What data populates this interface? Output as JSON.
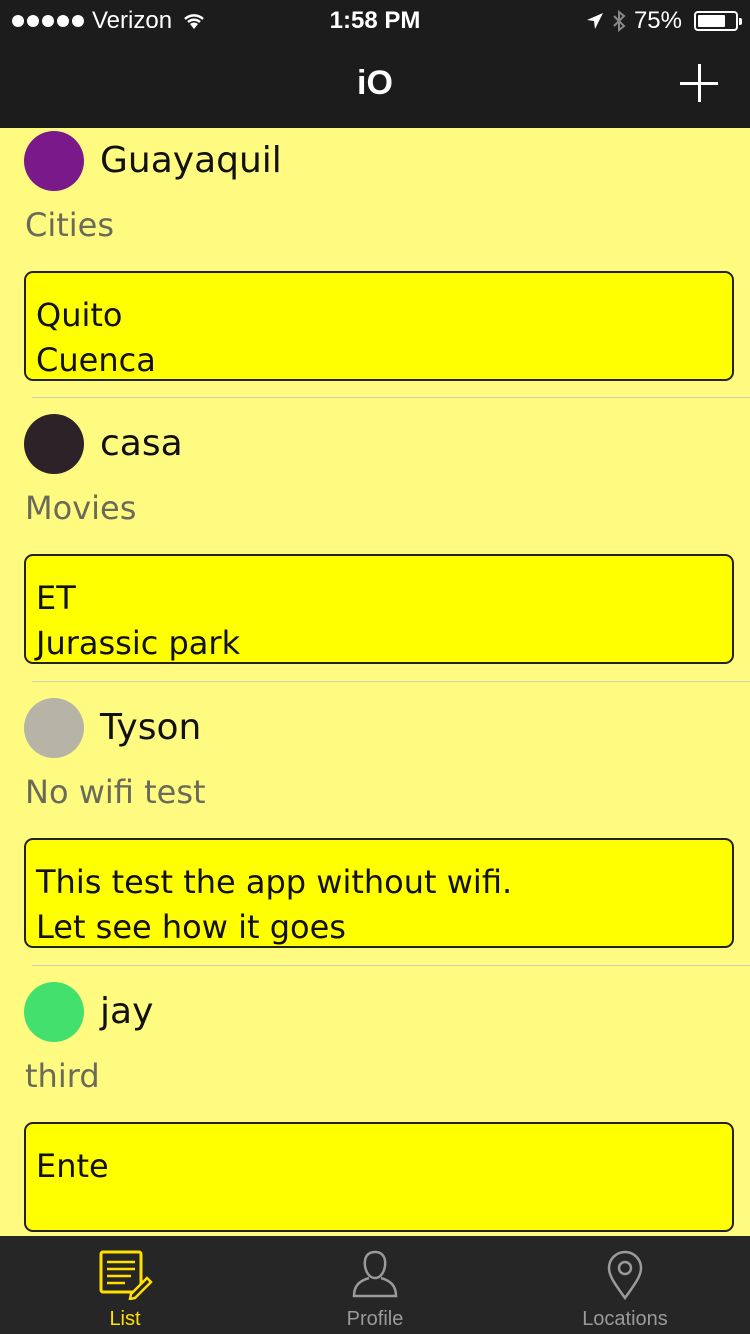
{
  "status_bar": {
    "carrier": "Verizon",
    "time": "1:58 PM",
    "battery": "75%",
    "battery_level": 0.75
  },
  "nav": {
    "title": "iO"
  },
  "items": [
    {
      "name": "Guayaquil",
      "category": "Cities",
      "color": "#7a1a8a",
      "lines": [
        "Quito",
        "Cuenca"
      ]
    },
    {
      "name": "casa",
      "category": "Movies",
      "color": "#2c2228",
      "lines": [
        "ET",
        "Jurassic park"
      ]
    },
    {
      "name": "Tyson",
      "category": "No wifi test",
      "color": "#b5b4a6",
      "lines": [
        "This test the app without wifi.",
        "Let see how it goes"
      ]
    },
    {
      "name": "jay",
      "category": "third",
      "color": "#44e06e",
      "lines": [
        "Ente",
        ""
      ]
    }
  ],
  "tabs": [
    {
      "label": "List",
      "icon": "list-icon",
      "active": true
    },
    {
      "label": "Profile",
      "icon": "profile-icon",
      "active": false
    },
    {
      "label": "Locations",
      "icon": "location-pin-icon",
      "active": false
    }
  ],
  "colors": {
    "background": "#fffb80",
    "note_box": "#ffff00",
    "bar": "#1c1c1c",
    "active_tab": "#ffe000"
  }
}
